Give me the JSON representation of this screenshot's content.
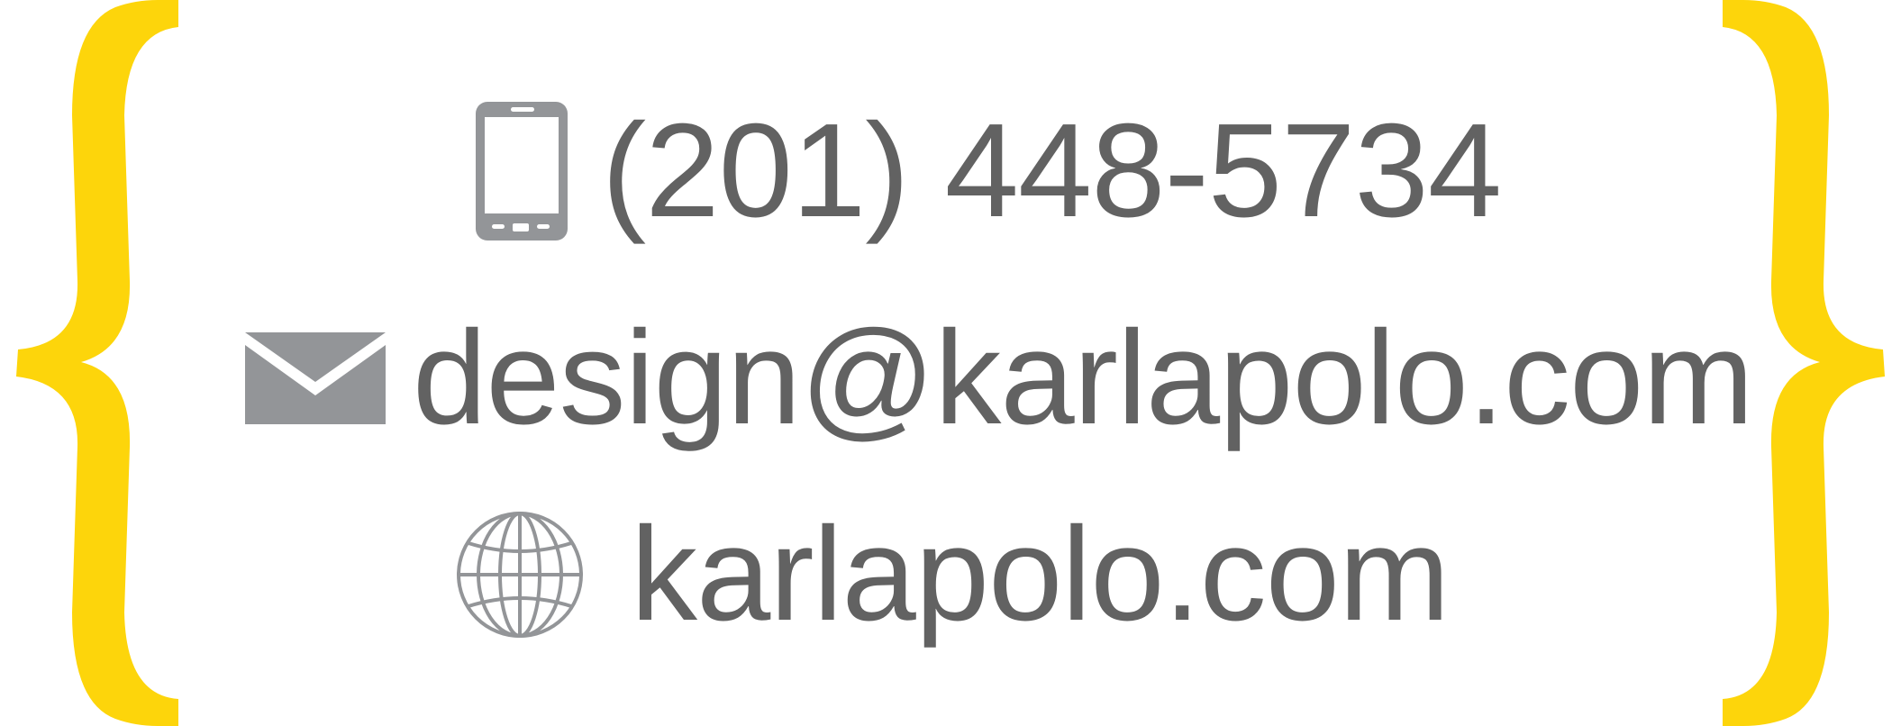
{
  "contact": {
    "phone": {
      "icon": "mobile-phone-icon",
      "text": "(201) 448-5734"
    },
    "email": {
      "icon": "envelope-icon",
      "text": "design@karlapolo.com"
    },
    "website": {
      "icon": "globe-icon",
      "text": "karlapolo.com"
    }
  },
  "colors": {
    "brace": "#FDD50B",
    "text": "#626262",
    "icon": "#939598"
  }
}
